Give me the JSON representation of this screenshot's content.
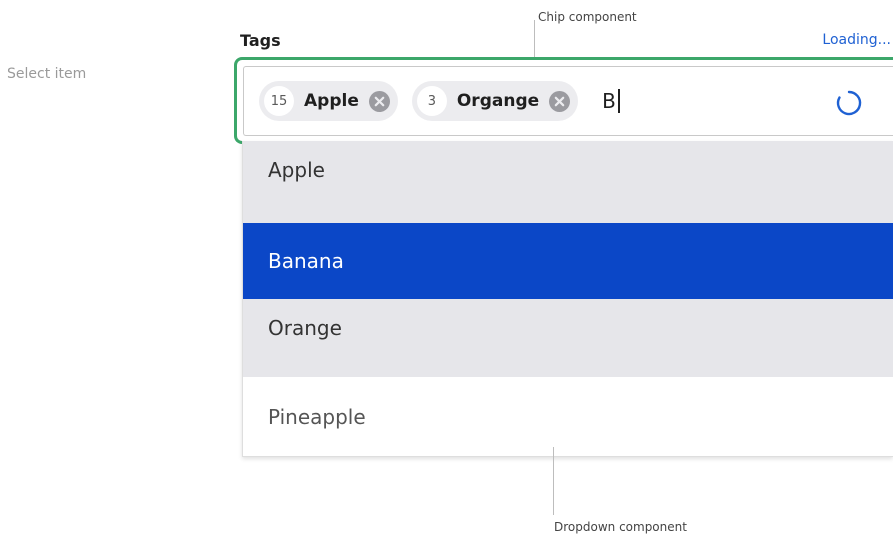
{
  "side_label": "Select item",
  "field": {
    "label": "Tags",
    "status_text": "Loading...",
    "typed_value": "B"
  },
  "chips": [
    {
      "count": "15",
      "label": "Apple",
      "remove_icon": "close-circle-icon"
    },
    {
      "count": "3",
      "label": "Organge",
      "remove_icon": "close-circle-icon"
    }
  ],
  "spinner_icon": "loading-spinner-icon",
  "dropdown": {
    "options": [
      "Apple",
      "Banana",
      "Orange",
      "Pineapple"
    ],
    "highlighted": "Banana"
  },
  "annotations": {
    "chip": "Chip component",
    "dropdown": "Dropdown component"
  },
  "colors": {
    "focus_border": "#3ca76a",
    "highlight": "#0b47c7",
    "link": "#1f61d3",
    "chip_bg": "#ececef"
  }
}
